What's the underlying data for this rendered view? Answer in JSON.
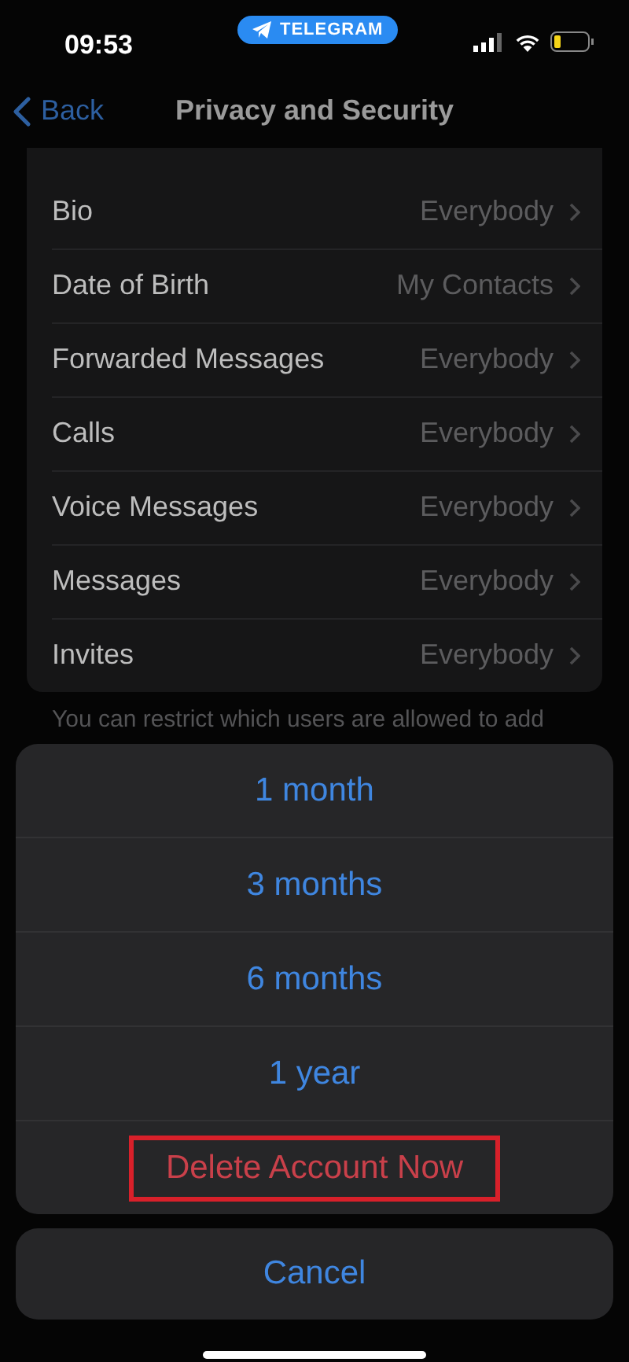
{
  "status_bar": {
    "time": "09:53",
    "app_pill": "TELEGRAM"
  },
  "nav": {
    "back": "Back",
    "title": "Privacy and Security"
  },
  "rows": [
    {
      "label": "Bio",
      "value": "Everybody"
    },
    {
      "label": "Date of Birth",
      "value": "My Contacts"
    },
    {
      "label": "Forwarded Messages",
      "value": "Everybody"
    },
    {
      "label": "Calls",
      "value": "Everybody"
    },
    {
      "label": "Voice Messages",
      "value": "Everybody"
    },
    {
      "label": "Messages",
      "value": "Everybody"
    },
    {
      "label": "Invites",
      "value": "Everybody"
    }
  ],
  "footer": "You can restrict which users are allowed to add",
  "action_sheet": {
    "options": [
      {
        "label": "1 month",
        "kind": "default",
        "highlighted": false
      },
      {
        "label": "3 months",
        "kind": "default",
        "highlighted": false
      },
      {
        "label": "6 months",
        "kind": "default",
        "highlighted": false
      },
      {
        "label": "1 year",
        "kind": "default",
        "highlighted": false
      },
      {
        "label": "Delete Account Now",
        "kind": "destructive",
        "highlighted": true
      }
    ],
    "cancel": "Cancel"
  }
}
